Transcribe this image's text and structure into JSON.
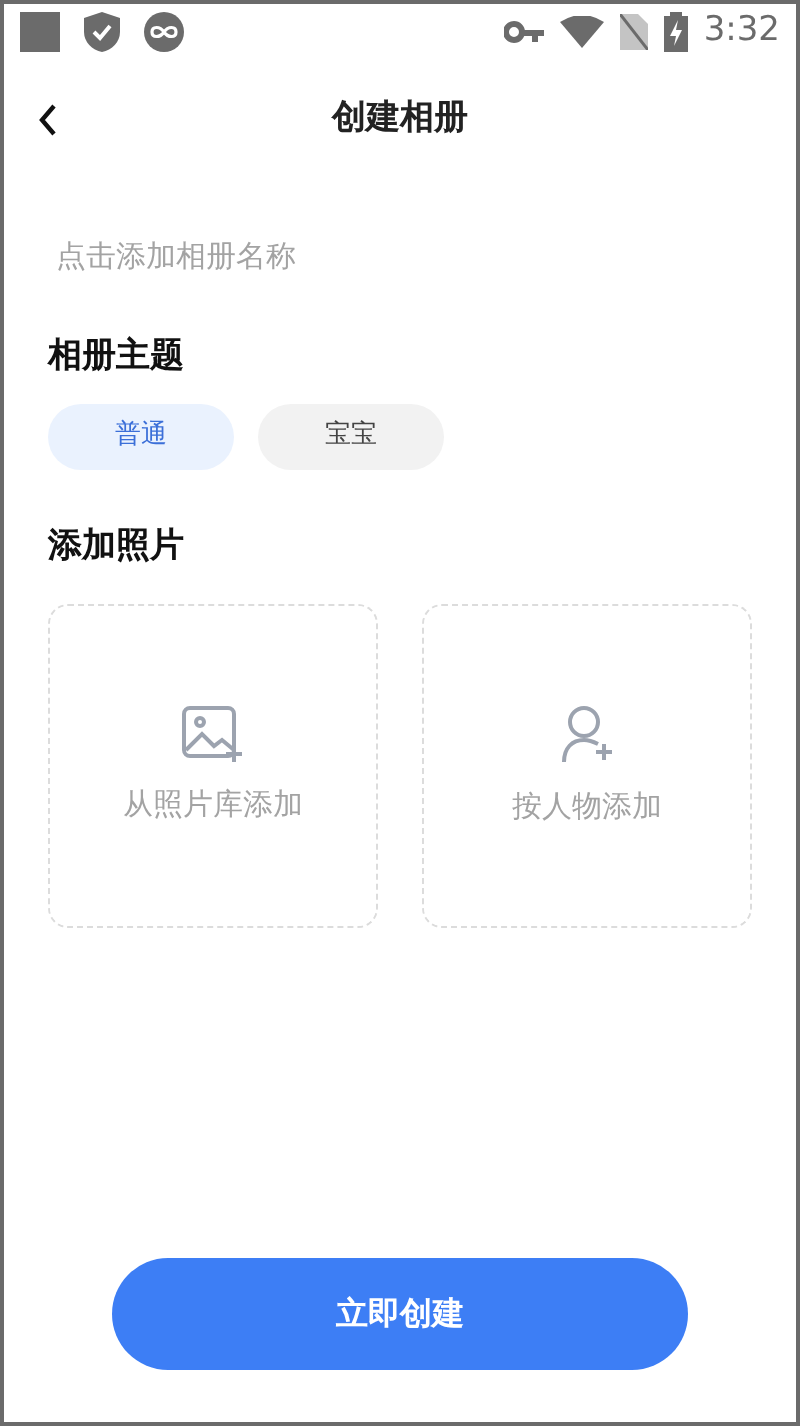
{
  "status_bar": {
    "time": "3:32"
  },
  "header": {
    "title": "创建相册"
  },
  "name_field": {
    "placeholder": "点击添加相册名称"
  },
  "theme": {
    "heading": "相册主题",
    "options": [
      {
        "label": "普通",
        "selected": true
      },
      {
        "label": "宝宝",
        "selected": false
      }
    ]
  },
  "photos": {
    "heading": "添加照片",
    "sources": [
      {
        "kind": "library",
        "label": "从照片库添加"
      },
      {
        "kind": "person",
        "label": "按人物添加"
      }
    ]
  },
  "create_button": {
    "label": "立即创建"
  }
}
